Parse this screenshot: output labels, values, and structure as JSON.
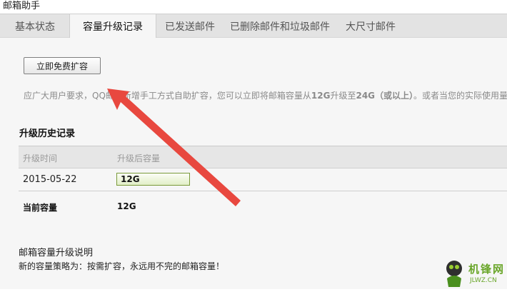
{
  "window": {
    "title": "邮箱助手"
  },
  "tabs": [
    {
      "label": "基本状态"
    },
    {
      "label": "容量升级记录"
    },
    {
      "label": "已发送邮件"
    },
    {
      "label": "已删除邮件和垃圾邮件"
    },
    {
      "label": "大尺寸邮件"
    }
  ],
  "active_tab": "容量升级记录",
  "upgrade": {
    "button_label": "立即免费扩容",
    "notice_parts": {
      "p1": "应广大用户要求，QQ邮箱新增手工方式自助扩容，您可以立即将邮箱容量从",
      "from": "12G",
      "p2": "升级至",
      "to": "24G（或以上）",
      "p3": "。或者当您的实际使用量"
    }
  },
  "history": {
    "title": "升级历史记录",
    "headers": {
      "time": "升级时间",
      "capacity": "升级后容量"
    },
    "rows": [
      {
        "date": "2015-05-22",
        "capacity": "12G"
      }
    ],
    "current_label": "当前容量",
    "current_value": "12G"
  },
  "explain": {
    "title": "邮箱容量升级说明",
    "text": "新的容量策略为：按需扩容，永远用不完的邮箱容量！"
  },
  "watermark": {
    "brand": "机锋网",
    "url": "JLWZ.CN"
  },
  "colors": {
    "annotation_arrow": "#e8483f",
    "capacity_bar_border": "#7a9a3a"
  }
}
